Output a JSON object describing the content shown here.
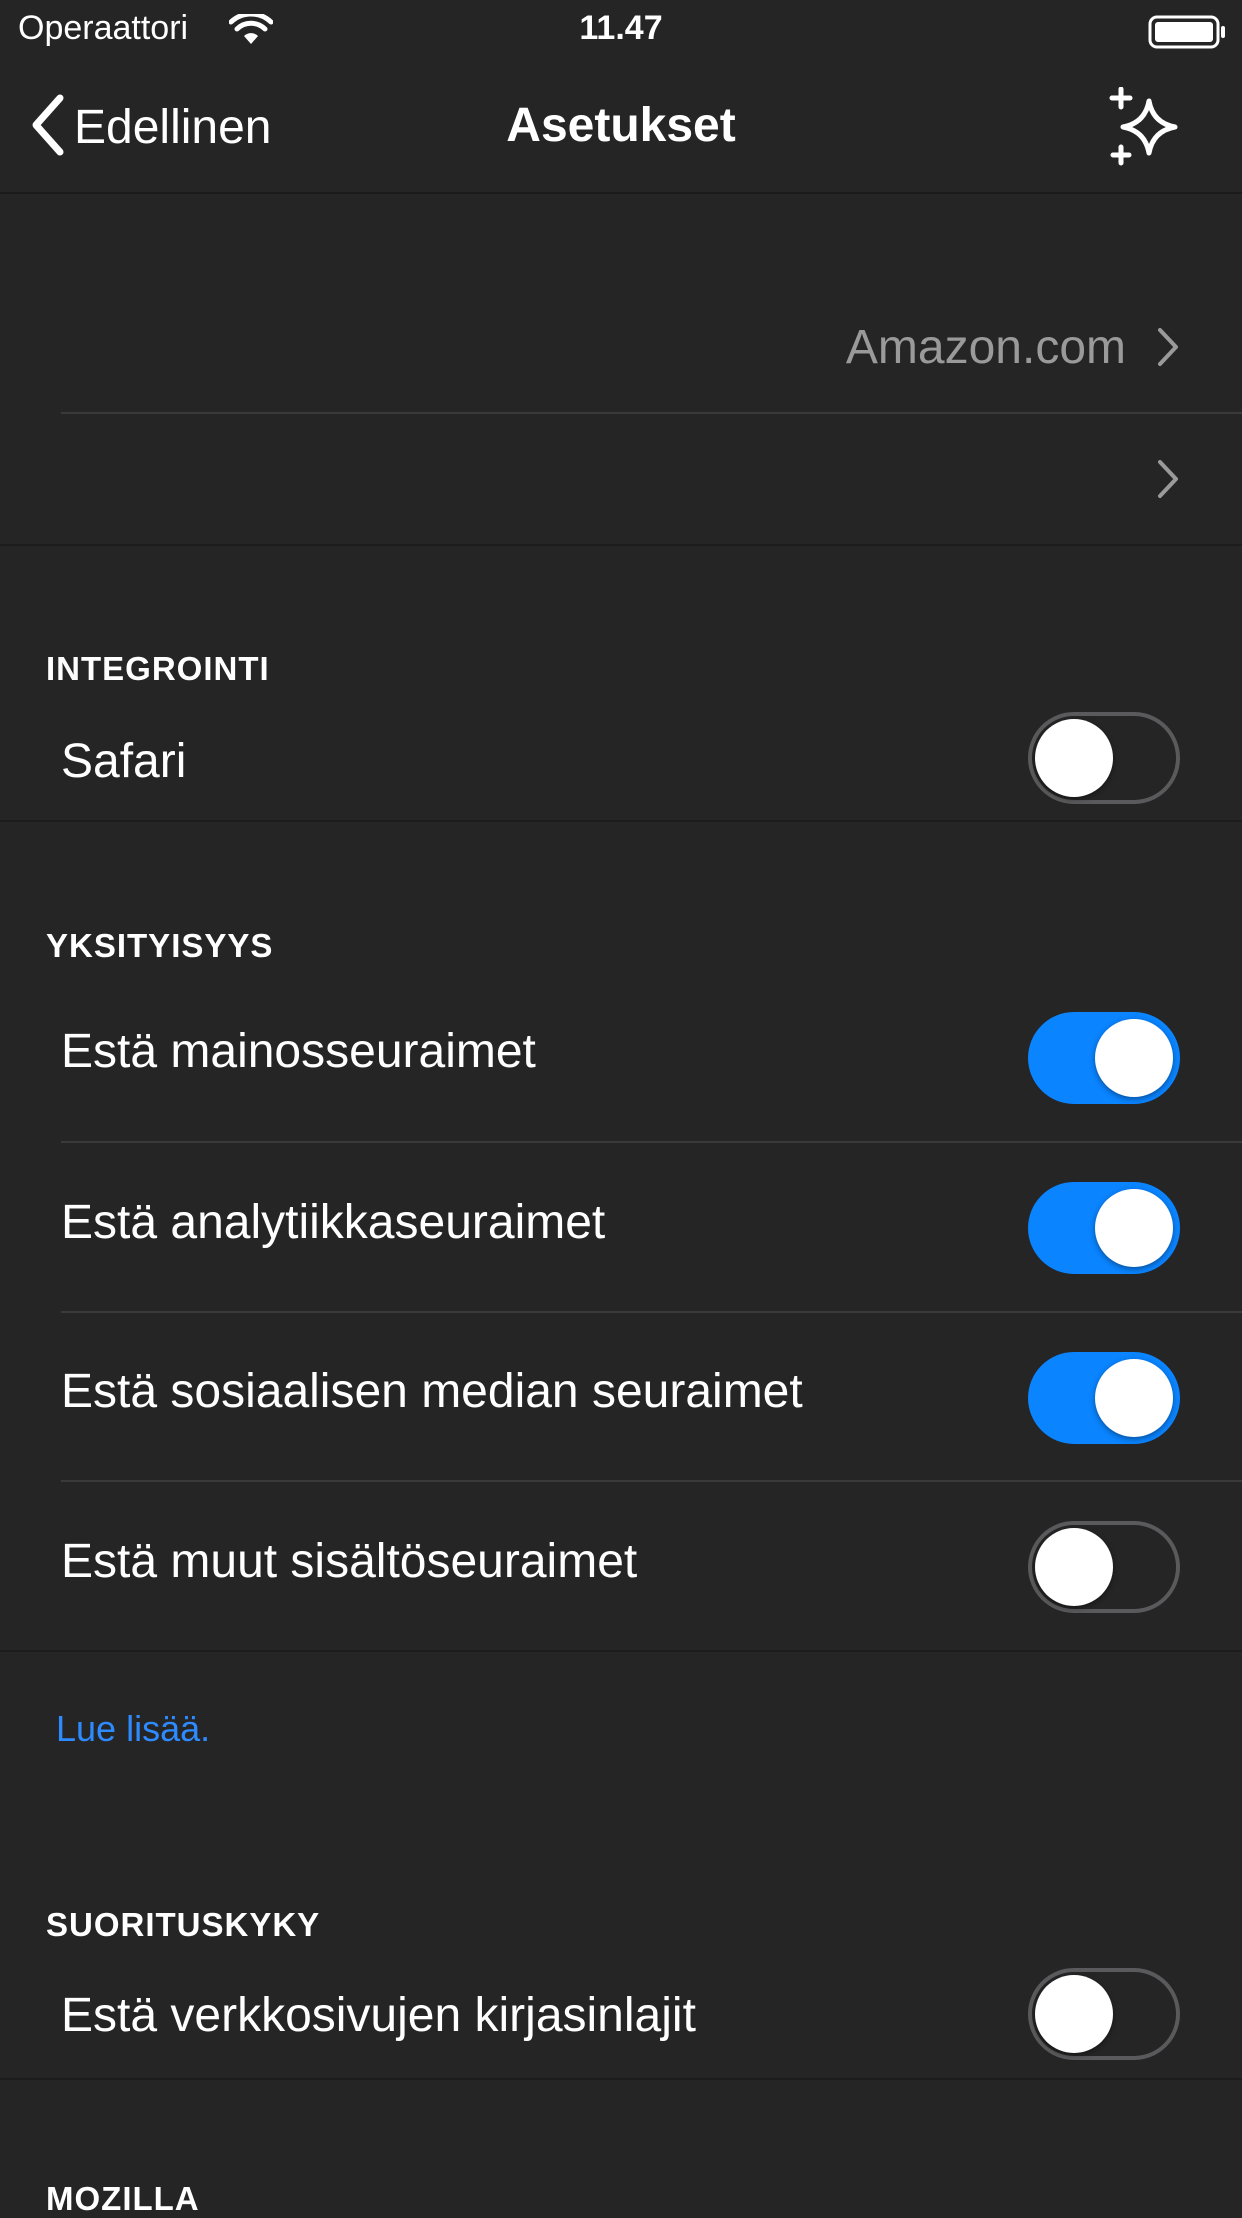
{
  "status_bar": {
    "carrier": "Operaattori",
    "time": "11.47",
    "icons": [
      "wifi-icon",
      "battery-icon"
    ]
  },
  "nav": {
    "back_label": "Edellinen",
    "title": "Asetukset",
    "right_icon": "sparkle-icon"
  },
  "top_group": {
    "search_engine_value": "Amazon.com"
  },
  "integration": {
    "header": "INTEGROINTI",
    "items": [
      {
        "label": "Safari",
        "on": false
      }
    ]
  },
  "privacy": {
    "header": "YKSITYISYYS",
    "items": [
      {
        "label": "Estä mainosseuraimet",
        "on": true
      },
      {
        "label": "Estä analytiikkaseuraimet",
        "on": true
      },
      {
        "label": "Estä sosiaalisen median seuraimet",
        "on": true
      },
      {
        "label": "Estä muut sisältöseuraimet",
        "on": false
      }
    ],
    "learn_more": "Lue lisää."
  },
  "performance": {
    "header": "SUORITUSKYKY",
    "items": [
      {
        "label": "Estä verkkosivujen kirjasinlajit",
        "on": false
      }
    ]
  },
  "mozilla": {
    "header": "MOZILLA"
  },
  "colors": {
    "background": "#252525",
    "accent": "#0a84ff",
    "link": "#2e8bff"
  }
}
